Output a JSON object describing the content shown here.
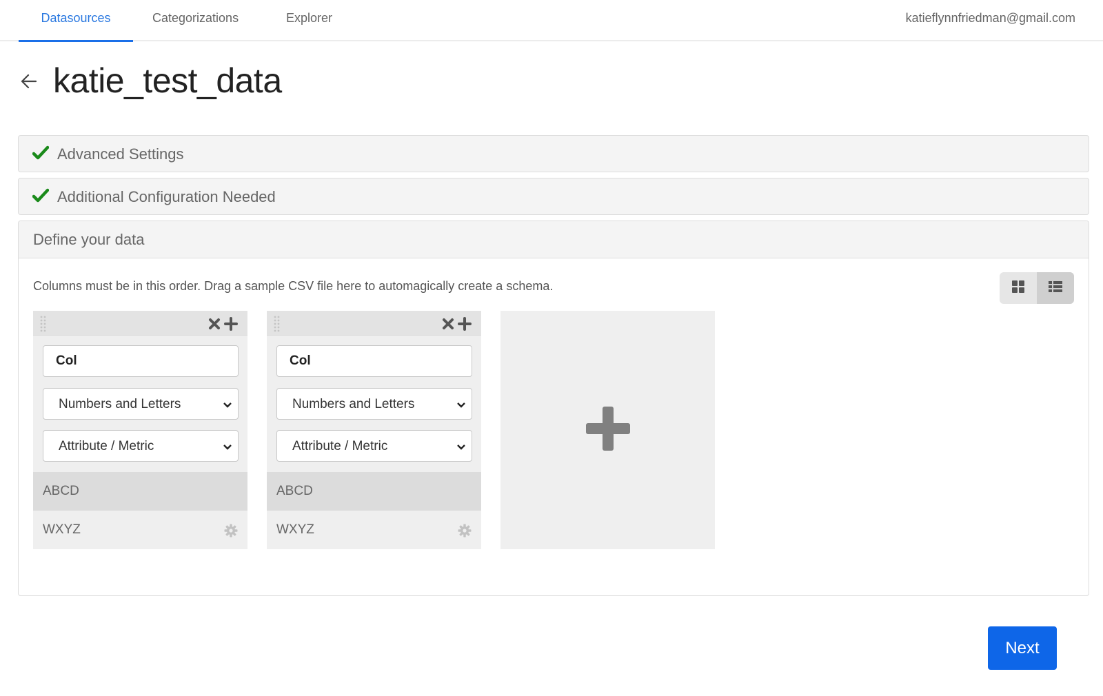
{
  "nav": {
    "tabs": [
      {
        "label": "Datasources",
        "active": true
      },
      {
        "label": "Categorizations",
        "active": false
      },
      {
        "label": "Explorer",
        "active": false
      }
    ],
    "user_email": "katieflynnfriedman@gmail.com"
  },
  "page": {
    "title": "katie_test_data",
    "back_icon": "arrow-left-icon"
  },
  "panels": {
    "advanced_settings": {
      "label": "Advanced Settings",
      "status_icon": "check-icon",
      "status_color": "#1a8a1a"
    },
    "additional_config": {
      "label": "Additional Configuration Needed",
      "status_icon": "check-icon",
      "status_color": "#1a8a1a"
    },
    "define_data": {
      "label": "Define your data",
      "description": "Columns must be in this order. Drag a sample CSV file here to automagically create a schema.",
      "view_toggle": {
        "options": [
          {
            "icon": "grid-view-icon",
            "active": false
          },
          {
            "icon": "list-view-icon",
            "active": true
          }
        ]
      },
      "columns": [
        {
          "name": "Col",
          "type_select": "Numbers and Letters",
          "role_select": "Attribute / Metric",
          "sample_rows": [
            "ABCD",
            "WXYZ"
          ]
        },
        {
          "name": "Col",
          "type_select": "Numbers and Letters",
          "role_select": "Attribute / Metric",
          "sample_rows": [
            "ABCD",
            "WXYZ"
          ]
        }
      ],
      "add_column_icon": "plus-icon"
    }
  },
  "actions": {
    "next_label": "Next",
    "primary_color": "#0e66e8"
  }
}
